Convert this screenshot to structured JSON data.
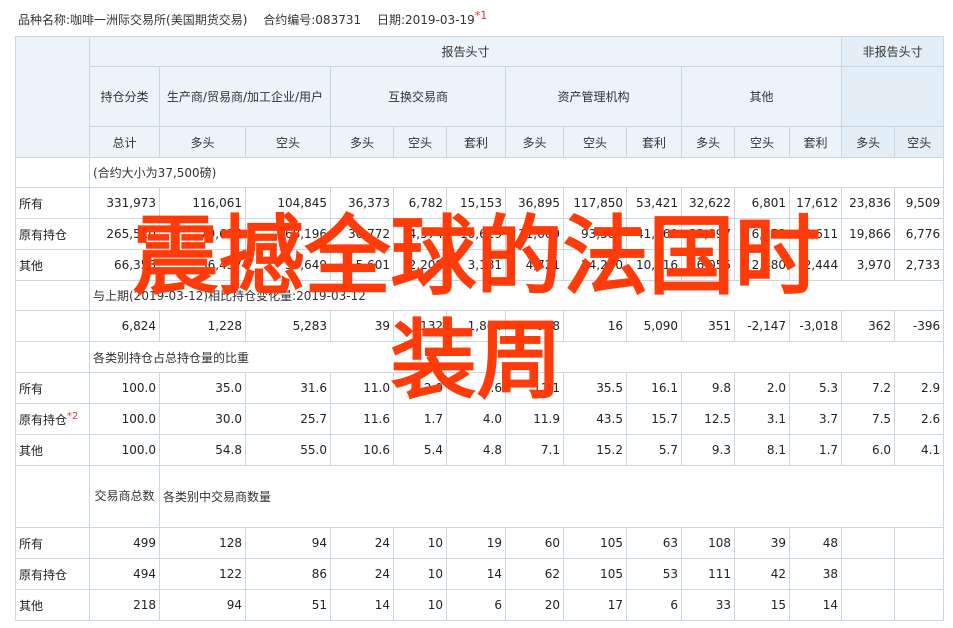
{
  "header": {
    "product": "品种名称:咖啡一洲际交易所(美国期货交易)",
    "contract": "合约编号:083731",
    "date": "日期:2019-03-19",
    "date_note": "*1"
  },
  "table": {
    "reportable": "报告头寸",
    "nonreportable": "非报告头寸",
    "position_class": "持仓分类",
    "producer": "生产商/贸易商/加工企业/用户",
    "swap": "互换交易商",
    "money": "资产管理机构",
    "other": "其他",
    "total": "总计",
    "long": "多头",
    "short": "空头",
    "spread": "套利",
    "section1": "(合约大小为37,500磅)",
    "section2": "与上期(2019-03-12)相比持仓变化量:2019-03-12",
    "section3": "各类别持仓占总持仓量的比重",
    "section4": "各类别中交易商数量",
    "trader_total": "交易商总数",
    "rows1": [
      [
        "所有",
        "331,973",
        "116,061",
        "104,845",
        "36,373",
        "6,782",
        "15,153",
        "36,895",
        "117,850",
        "53,421",
        "32,622",
        "6,801",
        "17,612",
        "23,836",
        "9,509"
      ],
      [
        "原有持仓",
        "265,520",
        "79,624",
        "68,196",
        "30,772",
        "4,574",
        "10,619",
        "31,669",
        "93,580",
        "41,960",
        "33,097",
        "6,253",
        "9,611",
        "19,866",
        "6,776"
      ],
      [
        "其他",
        "66,353",
        "36,437",
        "36,649",
        "5,601",
        "2,208",
        "3,181",
        "4,721",
        "24,270",
        "10,116",
        "6,055",
        "2,480",
        "2,444",
        "3,970",
        "2,733"
      ]
    ],
    "change_row": [
      "",
      "6,824",
      "1,228",
      "5,283",
      "39",
      "132",
      "1,864",
      "908",
      "16",
      "5,090",
      "351",
      "-2,147",
      "-3,018",
      "362",
      "-396"
    ],
    "rows3": [
      [
        "所有",
        "100.0",
        "35.0",
        "31.6",
        "11.0",
        "2.0",
        "4.6",
        "11.1",
        "35.5",
        "16.1",
        "9.8",
        "2.0",
        "5.3",
        "7.2",
        "2.9"
      ],
      [
        "原有持仓",
        "100.0",
        "30.0",
        "25.7",
        "11.6",
        "1.7",
        "4.0",
        "11.9",
        "43.5",
        "15.7",
        "12.5",
        "3.1",
        "3.7",
        "7.5",
        "2.6"
      ],
      [
        "其他",
        "100.0",
        "54.8",
        "55.0",
        "10.6",
        "5.4",
        "4.8",
        "7.1",
        "15.2",
        "5.7",
        "9.3",
        "8.1",
        "1.7",
        "6.0",
        "4.1"
      ]
    ],
    "row3_note": "*2",
    "rows4": [
      [
        "所有",
        "499",
        "128",
        "94",
        "24",
        "10",
        "19",
        "60",
        "105",
        "63",
        "108",
        "39",
        "48",
        "",
        ""
      ],
      [
        "原有持仓",
        "494",
        "122",
        "86",
        "24",
        "10",
        "14",
        "62",
        "105",
        "53",
        "111",
        "42",
        "38",
        "",
        ""
      ],
      [
        "其他",
        "218",
        "94",
        "51",
        "14",
        "10",
        "6",
        "20",
        "17",
        "6",
        "33",
        "15",
        "14",
        "",
        ""
      ]
    ]
  },
  "overlay": {
    "line1": "震撼全球的法国时",
    "line2": "装周"
  },
  "colors": {
    "border": "#c9d7e3",
    "header_bg": "#ecf3f9",
    "overlay_text": "#ff3b0a",
    "note": "#dd3333"
  }
}
